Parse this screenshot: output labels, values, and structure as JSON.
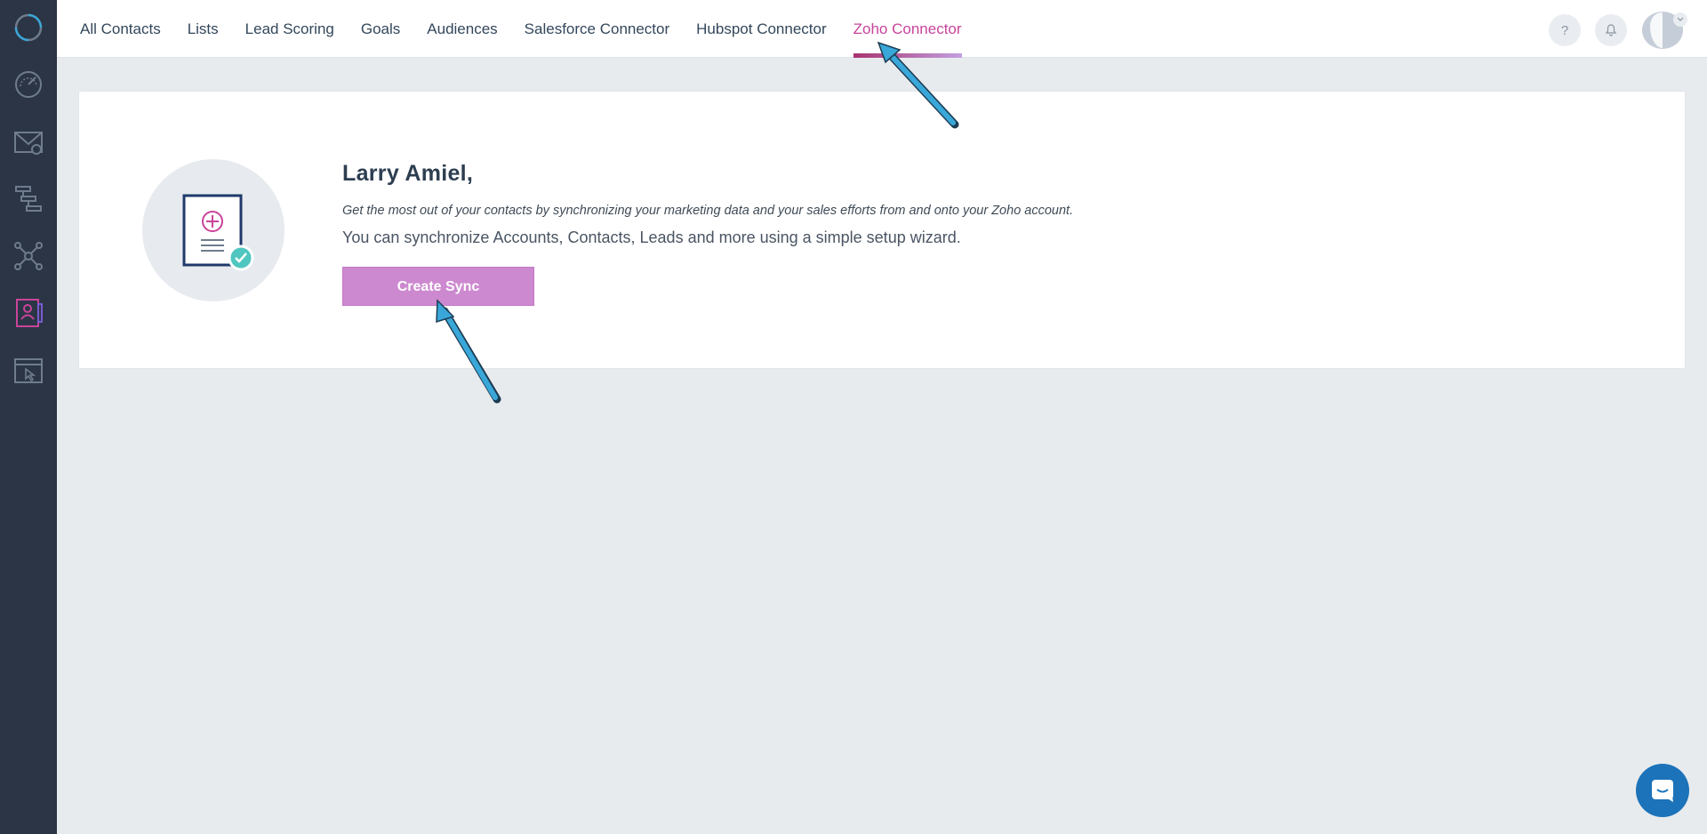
{
  "sidebar": {
    "icons": [
      "logo-ring-icon",
      "dashboard-gauge-icon",
      "email-icon",
      "automation-flow-icon",
      "network-icon",
      "contacts-icon",
      "landing-page-icon"
    ],
    "active_index": 5
  },
  "topnav": {
    "tabs": [
      {
        "label": "All Contacts"
      },
      {
        "label": "Lists"
      },
      {
        "label": "Lead Scoring"
      },
      {
        "label": "Goals"
      },
      {
        "label": "Audiences"
      },
      {
        "label": "Salesforce Connector"
      },
      {
        "label": "Hubspot Connector"
      },
      {
        "label": "Zoho Connector"
      }
    ],
    "active_tab": "Zoho Connector",
    "help_label": "?"
  },
  "card": {
    "greeting": "Larry Amiel,",
    "description_italic": "Get the most out of your contacts by synchronizing your marketing data and your sales efforts from and onto your Zoho account.",
    "description": "You can synchronize Accounts, Contacts, Leads and more using a simple setup wizard.",
    "create_button": "Create Sync"
  },
  "colors": {
    "sidebar_bg": "#2b3545",
    "accent": "#c9449a",
    "button_bg": "#cd89cf",
    "chat_bg": "#1c73b9",
    "annotation_arrow": "#3aa7d9"
  }
}
